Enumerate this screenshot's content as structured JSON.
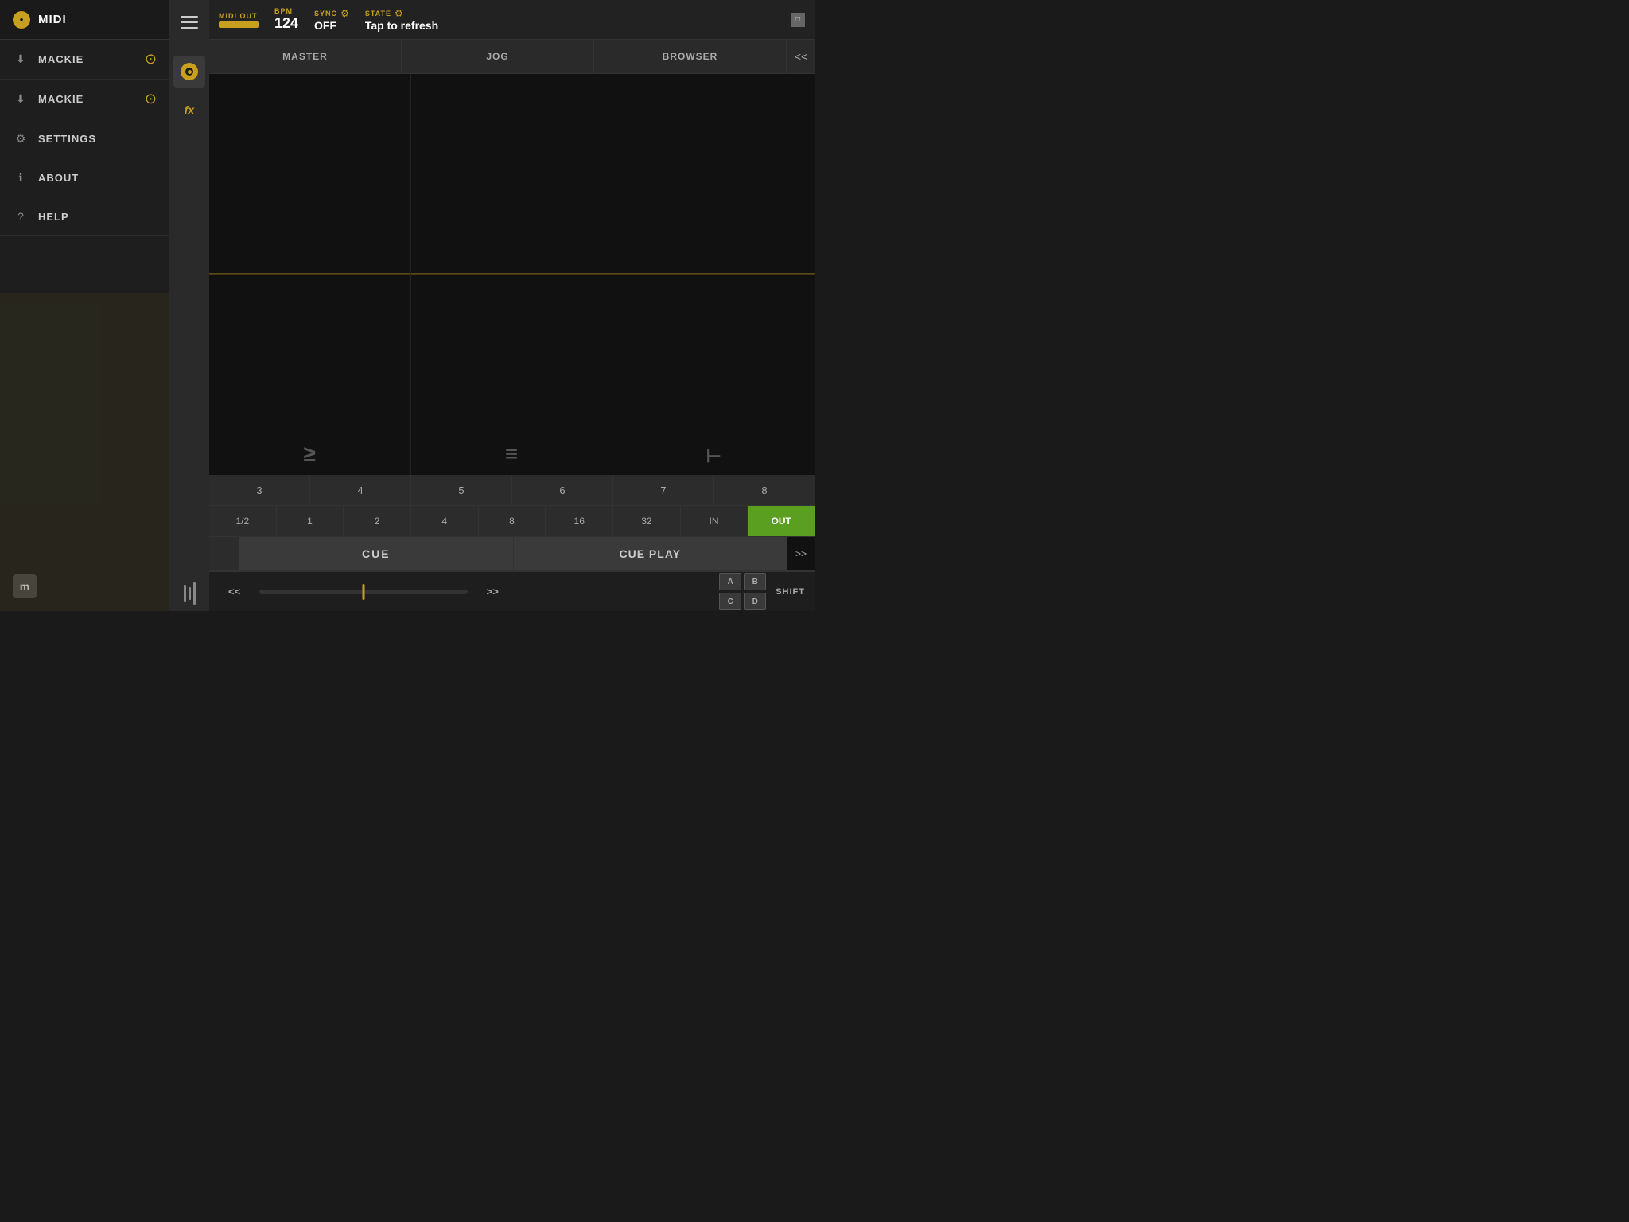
{
  "sidebar": {
    "title": "MIDI",
    "logo_char": "●",
    "items": [
      {
        "id": "mackie1",
        "label": "MACKIE",
        "icon": "download",
        "has_check": true
      },
      {
        "id": "mackie2",
        "label": "MACKIE",
        "icon": "download",
        "has_check": true
      },
      {
        "id": "settings",
        "label": "SETTINGS",
        "icon": "gear",
        "has_check": false
      },
      {
        "id": "about",
        "label": "ABOUT",
        "icon": "info",
        "has_check": false
      },
      {
        "id": "help",
        "label": "HELP",
        "icon": "question",
        "has_check": false
      }
    ],
    "bottom_logo": "m"
  },
  "topbar": {
    "midi_out_label": "MIDI OUT",
    "bpm_label": "BPM",
    "bpm_value": "124",
    "sync_label": "SYNC",
    "sync_gear": "⚙",
    "sync_value": "OFF",
    "state_label": "STATE",
    "state_gear": "⚙",
    "state_value": "Tap to refresh",
    "close_char": "□"
  },
  "tabs": {
    "items": [
      "MASTER",
      "JOG",
      "BROWSER"
    ],
    "nav_prev": "<<",
    "nav_next": ">>"
  },
  "number_row": {
    "buttons": [
      "3",
      "4",
      "5",
      "6",
      "7",
      "8"
    ]
  },
  "division_row": {
    "buttons": [
      "1/2",
      "1",
      "2",
      "4",
      "8",
      "16",
      "32",
      "IN",
      "OUT"
    ],
    "active": "OUT"
  },
  "cue_row": {
    "cue_label": "CUE",
    "cue_play_label": "CUE PLAY",
    "nav_next": ">>"
  },
  "transport": {
    "prev": "<<",
    "next": ">>",
    "shift_label": "SHIFT",
    "abcd": [
      "A",
      "B",
      "C",
      "D"
    ]
  },
  "waveform_icons": {
    "icon1": "≥",
    "icon2": "⁻",
    "icon3": "⌐"
  }
}
